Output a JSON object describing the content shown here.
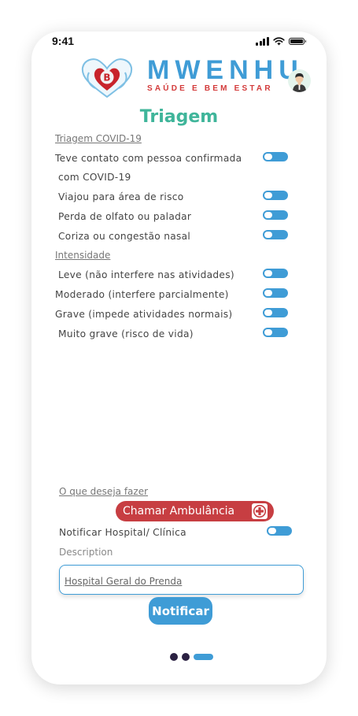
{
  "status_bar": {
    "time": "9:41"
  },
  "brand": {
    "name": "MWENHU",
    "tagline": "SAÚDE E BEM ESTAR",
    "logo_letter": "B"
  },
  "page": {
    "title": "Triagem"
  },
  "covid_section": {
    "heading": "Triagem COVID-19",
    "items": [
      {
        "label": "Teve contato com pessoa confirmada",
        "label2": "com COVID-19",
        "on": true
      },
      {
        "label": "Viajou para área de risco",
        "on": true
      },
      {
        "label": "Perda de olfato ou paladar",
        "on": true
      },
      {
        "label": "Coriza ou congestão nasal",
        "on": true
      }
    ]
  },
  "intensity_section": {
    "heading": "Intensidade",
    "items": [
      {
        "label": "Leve (não interfere nas atividades)",
        "on": true
      },
      {
        "label": "Moderado (interfere parcialmente)",
        "on": true
      },
      {
        "label": "Grave (impede atividades normais)",
        "on": true
      },
      {
        "label": "Muito grave (risco de vida)",
        "on": true
      }
    ]
  },
  "actions": {
    "heading": "O que deseja fazer",
    "ambulance_label": "Chamar Ambulância",
    "notify_hospital_label": "Notificar Hospital/ Clínica",
    "description_label": "Description",
    "description_value": "Hospital Geral do Prenda",
    "notify_button": "Notificar"
  },
  "colors": {
    "brand_blue": "#3f9cd6",
    "brand_red": "#d33a3a",
    "title_green": "#3fb59a",
    "ambulance_red": "#c73e42"
  }
}
